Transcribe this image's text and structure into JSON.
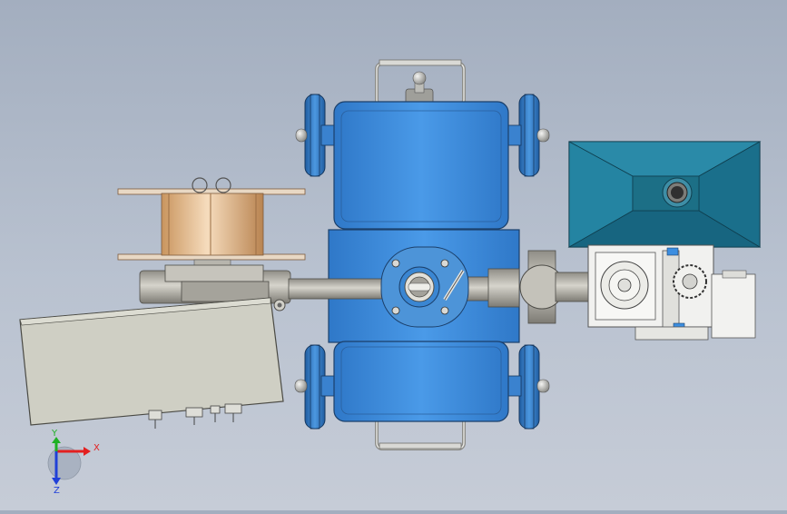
{
  "viewport": {
    "background_top": "#a3aebf",
    "background_bottom": "#c6ccd7"
  },
  "model": {
    "body_color": "#3c8ee0",
    "wheel_color": "#2f6fb5",
    "hopper_color": "#1c6f86",
    "spool_color": "#e8c29a",
    "shaft_color": "#b9b7ad",
    "pendant_color": "#cfcfc4",
    "gearbox_color": "#f1f1ef"
  },
  "triad": {
    "x_label": "X",
    "y_label": "Y",
    "z_label": "Z",
    "x_color": "#e32020",
    "y_color": "#1fb024",
    "z_color": "#2040d8",
    "icons": [
      "x-arrow-icon",
      "y-arrow-icon",
      "z-arrow-icon"
    ]
  }
}
